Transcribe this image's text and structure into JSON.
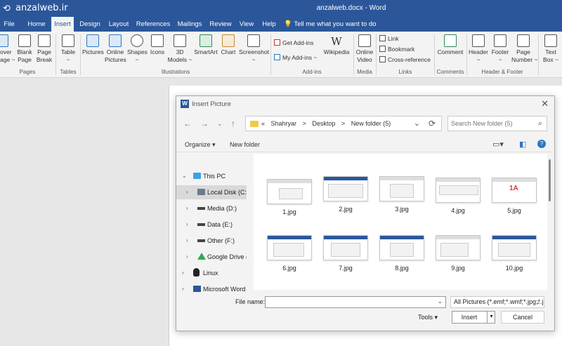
{
  "titlebar": {
    "watermark": "anzalweb.ir",
    "title": "anzalweb.docx  -  Word"
  },
  "tabs": [
    {
      "label": "File"
    },
    {
      "label": "Home"
    },
    {
      "label": "Insert"
    },
    {
      "label": "Design"
    },
    {
      "label": "Layout"
    },
    {
      "label": "References"
    },
    {
      "label": "Mailings"
    },
    {
      "label": "Review"
    },
    {
      "label": "View"
    },
    {
      "label": "Help"
    }
  ],
  "tell_me": "Tell me what you want to do",
  "ribbon": {
    "pages": {
      "cover": "over\nage ~",
      "blank": "Blank\nPage",
      "break": "Page\nBreak",
      "group": "Pages"
    },
    "tables": {
      "table": "Table\n~",
      "group": "Tables"
    },
    "illustrations": {
      "pictures": "Pictures",
      "online": "Online\nPictures",
      "shapes": "Shapes\n~",
      "icons": "Icons",
      "models": "3D\nModels ~",
      "smartart": "SmartArt",
      "chart": "Chart",
      "screenshot": "Screenshot\n~",
      "group": "Illustrations"
    },
    "addins": {
      "get": "Get Add-ins",
      "my": "My Add-ins ~",
      "wikipedia": "Wikipedia",
      "group": "Add-ins"
    },
    "media": {
      "video": "Online\nVideo",
      "group": "Media"
    },
    "links": {
      "link": "Link",
      "bookmark": "Bookmark",
      "cross": "Cross-reference",
      "group": "Links"
    },
    "comments": {
      "comment": "Comment",
      "group": "Comments"
    },
    "hf": {
      "header": "Header\n~",
      "footer": "Footer\n~",
      "pagenum": "Page\nNumber ~",
      "group": "Header & Footer"
    },
    "text": {
      "textbox": "Text\nBox ~"
    }
  },
  "dialog": {
    "title": "Insert Picture",
    "breadcrumb": [
      "«",
      "Shahryar",
      ">",
      "Desktop",
      ">",
      "New folder (5)"
    ],
    "search_placeholder": "Search New folder (5)",
    "organize": "Organize ▾",
    "new_folder": "New folder",
    "nav": [
      {
        "label": "This PC"
      },
      {
        "label": "Local Disk (C:)"
      },
      {
        "label": "Media (D:)"
      },
      {
        "label": "Data (E:)"
      },
      {
        "label": "Other (F:)"
      },
      {
        "label": "Google Drive ("
      },
      {
        "label": "Linux"
      },
      {
        "label": "Microsoft Word"
      }
    ],
    "files": [
      "1.jpg",
      "2.jpg",
      "3.jpg",
      "4.jpg",
      "5.jpg",
      "6.jpg",
      "7.jpg",
      "8.jpg",
      "9.jpg",
      "10.jpg"
    ],
    "file_name_label": "File name:",
    "file_name_value": "",
    "file_type": "All Pictures (*.emf;*.wmf;*.jpg;*.j",
    "tools": "Tools ▾",
    "insert": "Insert",
    "cancel": "Cancel"
  },
  "colors": {
    "brand": "#2b579a",
    "accent_blue": "#2b78c5"
  }
}
